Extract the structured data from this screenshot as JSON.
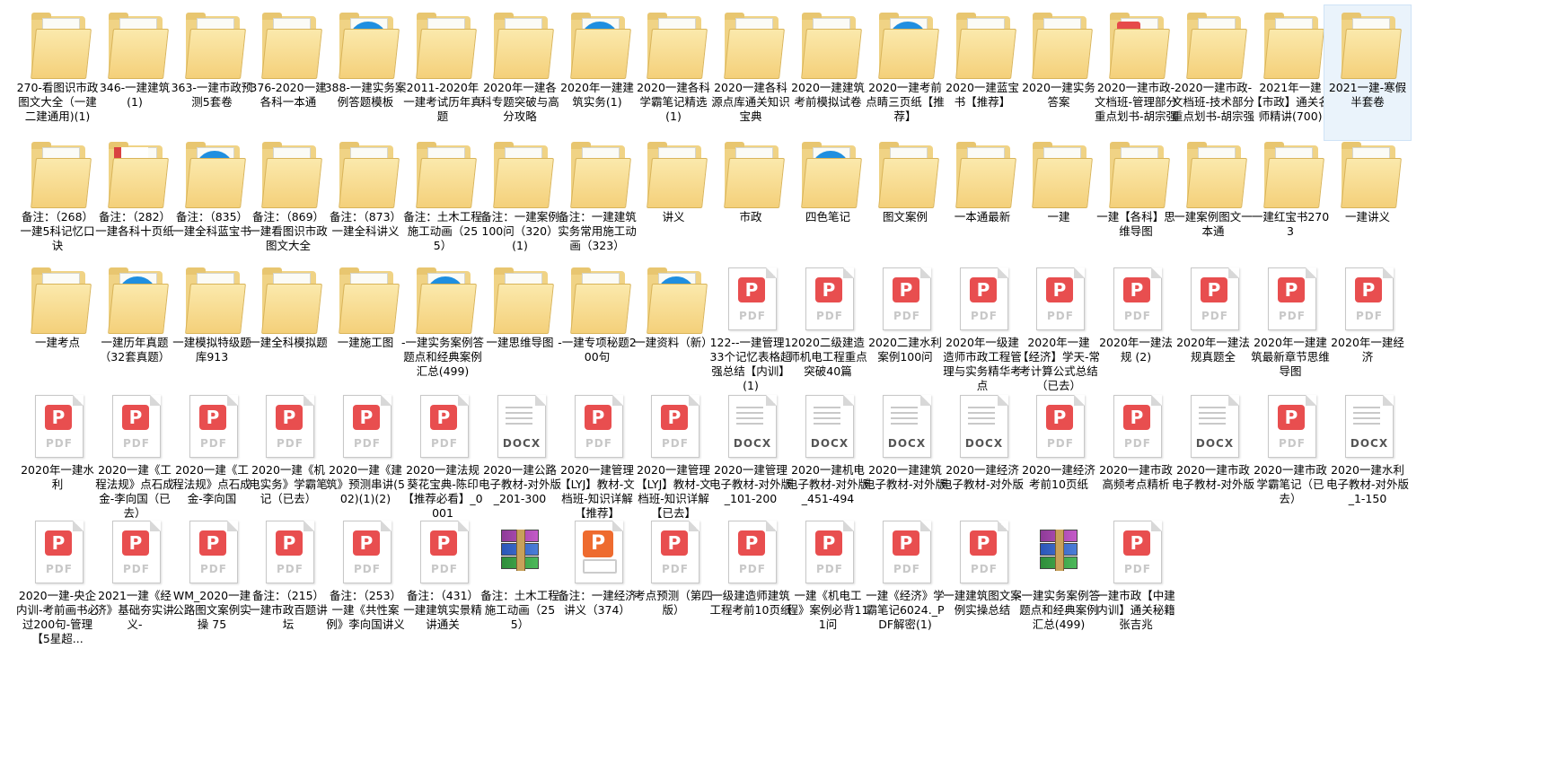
{
  "files": [
    {
      "label": "270-看图识市政图文大全（一建二建通用)(1)",
      "type": "folder",
      "icon": "folder-icon"
    },
    {
      "label": "346-一建建筑(1)",
      "type": "folder",
      "icon": "folder-icon"
    },
    {
      "label": "363-一建市政预测5套卷",
      "type": "folder",
      "icon": "folder-icon"
    },
    {
      "label": "376-2020一建各科一本通",
      "type": "folder",
      "icon": "folder-icon"
    },
    {
      "label": "388-一建实务案例答题模板",
      "type": "folder-ie",
      "icon": "folder-ie-icon"
    },
    {
      "label": "2011-2020年一建考试历年真题",
      "type": "folder",
      "icon": "folder-icon"
    },
    {
      "label": "2020年一建各科专题突破与高分攻略",
      "type": "folder",
      "icon": "folder-icon"
    },
    {
      "label": "2020年一建建筑实务(1)",
      "type": "folder-ie",
      "icon": "folder-ie-icon"
    },
    {
      "label": "2020一建各科学霸笔记精选(1)",
      "type": "folder",
      "icon": "folder-icon"
    },
    {
      "label": "2020一建各科源点库通关知识宝典",
      "type": "folder",
      "icon": "folder-icon"
    },
    {
      "label": "2020一建建筑考前模拟试卷",
      "type": "folder",
      "icon": "folder-icon"
    },
    {
      "label": "2020一建考前点睛三页纸【推荐】",
      "type": "folder-ie",
      "icon": "folder-ie-icon"
    },
    {
      "label": "2020一建蓝宝书【推荐】",
      "type": "folder",
      "icon": "folder-icon"
    },
    {
      "label": "2020一建实务答案",
      "type": "folder",
      "icon": "folder-icon"
    },
    {
      "label": "2020一建市政-文档班-管理部分重点划书-胡宗强",
      "type": "folder-pdf",
      "icon": "folder-pdf-icon"
    },
    {
      "label": "2020一建市政-文档班-技术部分重点划书-胡宗强",
      "type": "folder",
      "icon": "folder-icon"
    },
    {
      "label": "2021年一建【市政】通关名师精讲(700)",
      "type": "folder",
      "icon": "folder-icon"
    },
    {
      "label": "2021一建-寒假半套卷",
      "type": "folder",
      "icon": "folder-icon",
      "selected": true
    },
    {
      "label": "备注：（268）一建5科记忆口诀",
      "type": "folder",
      "icon": "folder-icon"
    },
    {
      "label": "备注：（282）一建各科十页纸",
      "type": "folder-red",
      "icon": "folder-red-sheet-icon"
    },
    {
      "label": "备注：（835）一建全科蓝宝书",
      "type": "folder-ie",
      "icon": "folder-ie-icon"
    },
    {
      "label": "备注：（869）一建看图识市政图文大全",
      "type": "folder",
      "icon": "folder-icon"
    },
    {
      "label": "备注：（873）一建全科讲义",
      "type": "folder",
      "icon": "folder-icon"
    },
    {
      "label": "备注：土木工程施工动画（255）",
      "type": "folder",
      "icon": "folder-icon"
    },
    {
      "label": "备注：一建案例100问（320）(1)",
      "type": "folder",
      "icon": "folder-icon"
    },
    {
      "label": "备注：一建建筑实务常用施工动画（323）",
      "type": "folder",
      "icon": "folder-icon"
    },
    {
      "label": "讲义",
      "type": "folder",
      "icon": "folder-icon"
    },
    {
      "label": "市政",
      "type": "folder",
      "icon": "folder-icon"
    },
    {
      "label": "四色笔记",
      "type": "folder-ie",
      "icon": "folder-ie-icon"
    },
    {
      "label": "图文案例",
      "type": "folder",
      "icon": "folder-icon"
    },
    {
      "label": "一本通最新",
      "type": "folder",
      "icon": "folder-icon"
    },
    {
      "label": "一建",
      "type": "folder",
      "icon": "folder-icon"
    },
    {
      "label": "一建【各科】思维导图",
      "type": "folder",
      "icon": "folder-icon"
    },
    {
      "label": "一建案例图文一本通",
      "type": "folder",
      "icon": "folder-icon"
    },
    {
      "label": "一建红宝书2703",
      "type": "folder",
      "icon": "folder-icon"
    },
    {
      "label": "一建讲义",
      "type": "folder",
      "icon": "folder-icon"
    },
    {
      "label": "一建考点",
      "type": "folder",
      "icon": "folder-icon"
    },
    {
      "label": "一建历年真题（32套真题）",
      "type": "folder-ie",
      "icon": "folder-ie-icon"
    },
    {
      "label": "一建模拟特级题库913",
      "type": "folder",
      "icon": "folder-icon"
    },
    {
      "label": "一建全科模拟题",
      "type": "folder",
      "icon": "folder-icon"
    },
    {
      "label": "一建施工图",
      "type": "folder",
      "icon": "folder-icon"
    },
    {
      "label": "-一建实务案例答题点和经典案例汇总(499)",
      "type": "folder-ie",
      "icon": "folder-ie-icon"
    },
    {
      "label": "一建思维导图",
      "type": "folder",
      "icon": "folder-icon"
    },
    {
      "label": "-一建专项秘题200句",
      "type": "folder",
      "icon": "folder-icon"
    },
    {
      "label": "一建资料（新）",
      "type": "folder-ie",
      "icon": "folder-ie-icon"
    },
    {
      "label": "122--一建管理133个记忆表格超强总结【内训】(1)",
      "type": "pdf",
      "icon": "pdf-file-icon"
    },
    {
      "label": "2020二级建造师机电工程重点突破40篇",
      "type": "pdf",
      "icon": "pdf-file-icon"
    },
    {
      "label": "2020二建水利案例100问",
      "type": "pdf",
      "icon": "pdf-file-icon"
    },
    {
      "label": "2020年一级建造师市政工程管理与实务精华考点",
      "type": "pdf",
      "icon": "pdf-file-icon"
    },
    {
      "label": "2020年一建【经济】学天-常考计算公式总结（已去）",
      "type": "pdf",
      "icon": "pdf-file-icon"
    },
    {
      "label": "2020年一建法规 (2)",
      "type": "pdf",
      "icon": "pdf-file-icon"
    },
    {
      "label": "2020年一建法规真题全",
      "type": "pdf",
      "icon": "pdf-file-icon"
    },
    {
      "label": "2020年一建建筑最新章节思维导图",
      "type": "pdf",
      "icon": "pdf-file-icon"
    },
    {
      "label": "2020年一建经济",
      "type": "pdf",
      "icon": "pdf-file-icon"
    },
    {
      "label": "2020年一建水利",
      "type": "pdf",
      "icon": "pdf-file-icon"
    },
    {
      "label": "2020一建《工程法规》点石成金-李向国（已去）",
      "type": "pdf",
      "icon": "pdf-file-icon"
    },
    {
      "label": "2020一建《工程法规》点石成金-李向国",
      "type": "pdf",
      "icon": "pdf-file-icon"
    },
    {
      "label": "2020一建《机电实务》学霸笔记（已去）",
      "type": "pdf",
      "icon": "pdf-file-icon"
    },
    {
      "label": "2020一建《建筑》预测串讲(502)(1)(2)",
      "type": "pdf",
      "icon": "pdf-file-icon"
    },
    {
      "label": "2020一建法规葵花宝典-陈印【推荐必看】_0001",
      "type": "pdf",
      "icon": "pdf-file-icon"
    },
    {
      "label": "2020一建公路电子教材-对外版_201-300",
      "type": "docx",
      "icon": "docx-file-icon"
    },
    {
      "label": "2020一建管理【LYJ】教材-文档班-知识详解【推荐】",
      "type": "pdf",
      "icon": "pdf-file-icon"
    },
    {
      "label": "2020一建管理【LYJ】教材-文档班-知识详解【已去】",
      "type": "pdf",
      "icon": "pdf-file-icon"
    },
    {
      "label": "2020一建管理电子教材-对外版_101-200",
      "type": "docx",
      "icon": "docx-file-icon"
    },
    {
      "label": "2020一建机电电子教材-对外版_451-494",
      "type": "docx",
      "icon": "docx-file-icon"
    },
    {
      "label": "2020一建建筑电子教材-对外版",
      "type": "docx",
      "icon": "docx-file-icon"
    },
    {
      "label": "2020一建经济电子教材-对外版",
      "type": "docx",
      "icon": "docx-file-icon"
    },
    {
      "label": "2020一建经济考前10页纸",
      "type": "pdf",
      "icon": "pdf-file-icon"
    },
    {
      "label": "2020一建市政高频考点精析",
      "type": "pdf",
      "icon": "pdf-file-icon"
    },
    {
      "label": "2020一建市政电子教材-对外版",
      "type": "docx",
      "icon": "docx-file-icon"
    },
    {
      "label": "2020一建市政学霸笔记（已去）",
      "type": "pdf",
      "icon": "pdf-file-icon"
    },
    {
      "label": "2020一建水利电子教材-对外版_1-150",
      "type": "docx",
      "icon": "docx-file-icon"
    },
    {
      "label": "2020一建-央企内训-考前画书必过200句-管理【5星超...",
      "type": "pdf",
      "icon": "pdf-file-icon"
    },
    {
      "label": "2021一建《经济》基础夯实讲义-",
      "type": "pdf",
      "icon": "pdf-file-icon"
    },
    {
      "label": "WM_2020一建公路图文案例实操 75",
      "type": "pdf",
      "icon": "pdf-file-icon"
    },
    {
      "label": "备注：（215）一建市政百题讲坛",
      "type": "pdf",
      "icon": "pdf-file-icon"
    },
    {
      "label": "备注：（253）一建《共性案例》李向国讲义",
      "type": "pdf",
      "icon": "pdf-file-icon"
    },
    {
      "label": "备注：（431）一建建筑实景精讲通关",
      "type": "pdf",
      "icon": "pdf-file-icon"
    },
    {
      "label": "备注：土木工程施工动画（255）",
      "type": "rar",
      "icon": "rar-archive-icon"
    },
    {
      "label": "备注：一建经济讲义（374）",
      "type": "wps",
      "icon": "wps-doc-icon"
    },
    {
      "label": "考点预测（第四版）",
      "type": "pdf",
      "icon": "pdf-file-icon"
    },
    {
      "label": "一级建造师建筑工程考前10页纸",
      "type": "pdf",
      "icon": "pdf-file-icon"
    },
    {
      "label": "一建《机电工程》案例必背111问",
      "type": "pdf",
      "icon": "pdf-file-icon"
    },
    {
      "label": "一建《经济》学霸笔记6024._PDF解密(1)",
      "type": "pdf",
      "icon": "pdf-file-icon"
    },
    {
      "label": "一建建筑图文案例实操总结",
      "type": "pdf",
      "icon": "pdf-file-icon"
    },
    {
      "label": "-一建实务案例答题点和经典案例汇总(499)",
      "type": "rar",
      "icon": "rar-archive-icon"
    },
    {
      "label": "一建市政【中建内训】通关秘籍张吉兆",
      "type": "pdf",
      "icon": "pdf-file-icon"
    }
  ],
  "icon_text": {
    "pdf": "PDF",
    "docx": "DOCX",
    "pdf_glyph": "P",
    "wps_glyph": "P"
  },
  "colors": {
    "selection": "#eaf3fb",
    "pdf_red": "#e84e4f",
    "folder": "#f4d07a",
    "ie_blue": "#1f8fe0"
  }
}
